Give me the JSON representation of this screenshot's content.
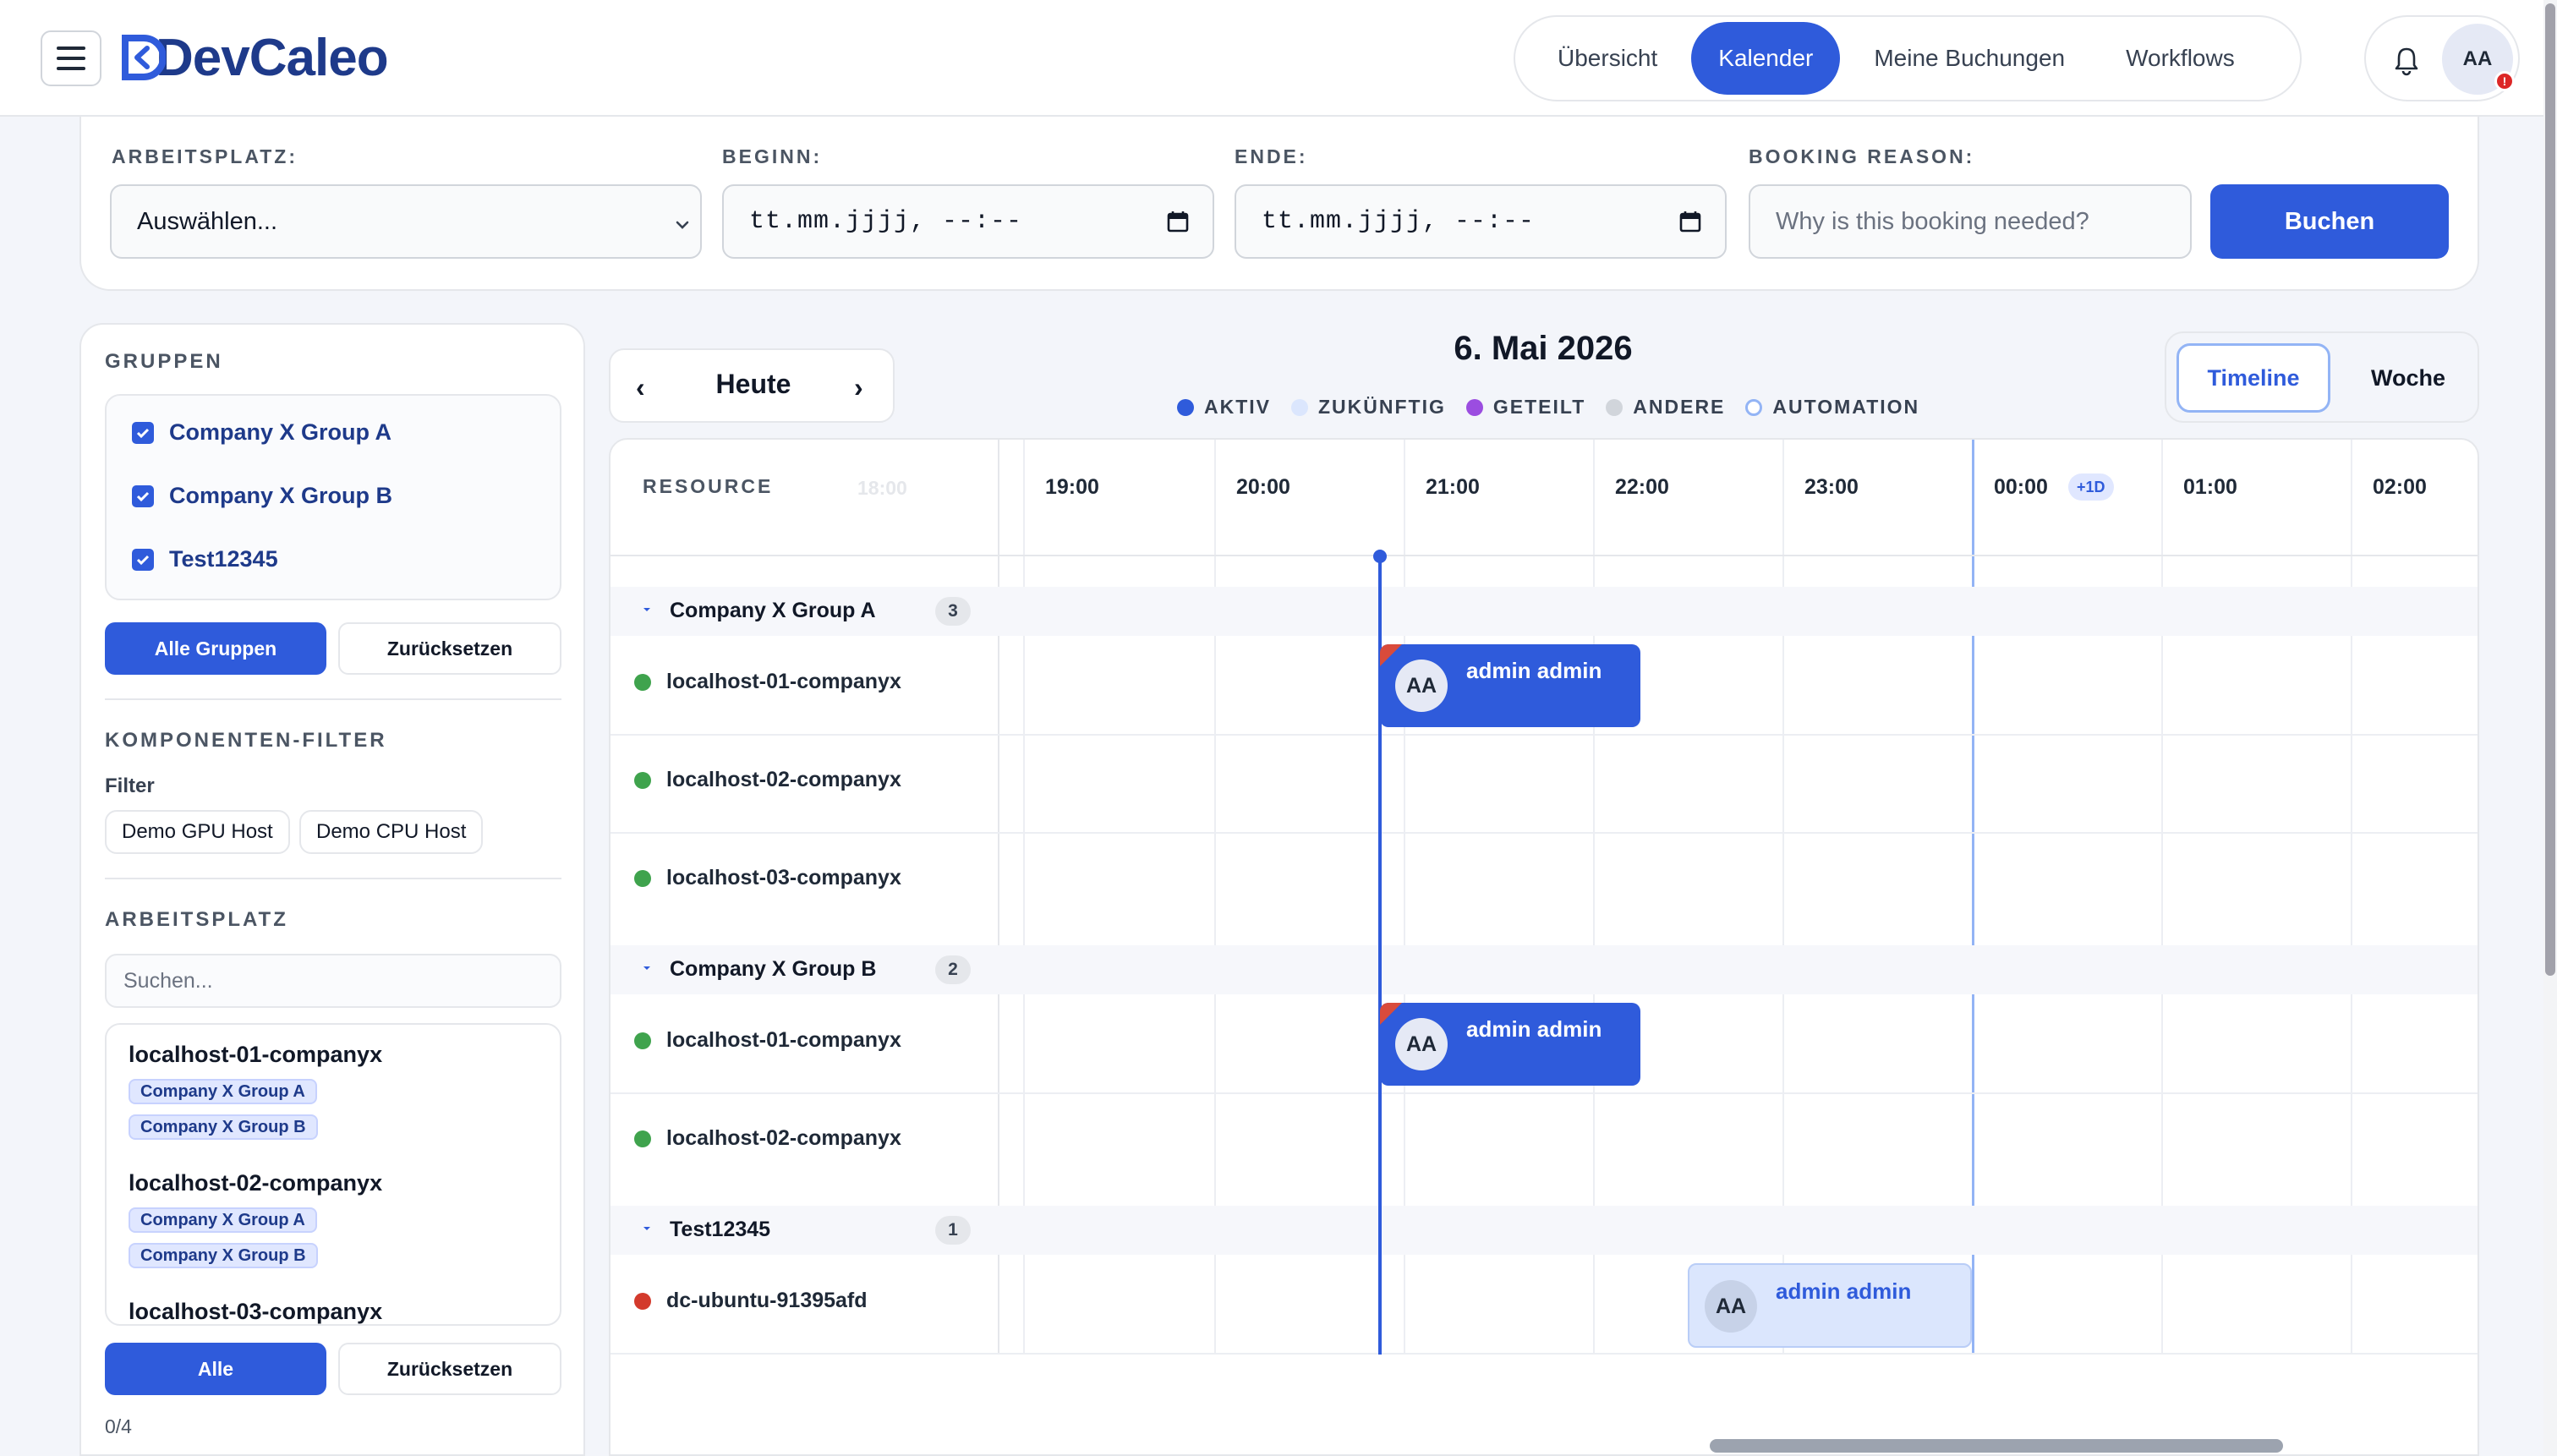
{
  "app": {
    "brand": "DevCaleo"
  },
  "nav": {
    "tabs": [
      {
        "label": "Übersicht",
        "active": false
      },
      {
        "label": "Kalender",
        "active": true
      },
      {
        "label": "Meine Buchungen",
        "active": false
      },
      {
        "label": "Workflows",
        "active": false
      }
    ]
  },
  "user": {
    "initials": "AA",
    "alert": "!"
  },
  "booking_form": {
    "workplace_label": "ARBEITSPLATZ:",
    "workplace_value": "Auswählen...",
    "start_label": "BEGINN:",
    "start_value": "tt.mm.jjjj, --:--",
    "end_label": "ENDE:",
    "end_value": "tt.mm.jjjj, --:--",
    "reason_label": "BOOKING REASON:",
    "reason_placeholder": "Why is this booking needed?",
    "submit_label": "Buchen"
  },
  "sidebar": {
    "groups_title": "GRUPPEN",
    "groups": [
      {
        "label": "Company X Group A",
        "checked": true
      },
      {
        "label": "Company X Group B",
        "checked": true
      },
      {
        "label": "Test12345",
        "checked": true
      }
    ],
    "groups_all_label": "Alle Gruppen",
    "groups_reset_label": "Zurücksetzen",
    "component_filter_title": "KOMPONENTEN-FILTER",
    "filter_label": "Filter",
    "filter_chips": [
      "Demo GPU Host",
      "Demo CPU Host"
    ],
    "workplace_title": "ARBEITSPLATZ",
    "search_placeholder": "Suchen...",
    "workplaces": [
      {
        "name": "localhost-01-companyx",
        "tags": [
          "Company X Group A",
          "Company X Group B"
        ]
      },
      {
        "name": "localhost-02-companyx",
        "tags": [
          "Company X Group A",
          "Company X Group B"
        ]
      },
      {
        "name": "localhost-03-companyx",
        "tags": []
      }
    ],
    "all_label": "Alle",
    "reset_label": "Zurücksetzen",
    "counter": "0/4"
  },
  "calendar": {
    "today_label": "Heute",
    "prev": "‹",
    "next": "›",
    "date_title": "6. Mai 2026",
    "legend": [
      {
        "label": "AKTIV",
        "color": "#2f5bdb"
      },
      {
        "label": "ZUKÜNFTIG",
        "color": "#dbe6fd"
      },
      {
        "label": "GETEILT",
        "color": "#9b4de0"
      },
      {
        "label": "ANDERE",
        "color": "#d1d5db"
      },
      {
        "label": "AUTOMATION",
        "color": "#93b4f5"
      }
    ],
    "views": {
      "timeline": "Timeline",
      "week": "Woche"
    },
    "resource_header": "RESOURCE",
    "ghost_hour": "18:00",
    "hours": [
      "19:00",
      "20:00",
      "21:00",
      "22:00",
      "23:00",
      "00:00",
      "01:00",
      "02:00"
    ],
    "next_day_badge": "+1D",
    "groups": [
      {
        "name": "Company X Group A",
        "count": "3",
        "rows": [
          {
            "name": "localhost-01-companyx",
            "status": "#3fa34d"
          },
          {
            "name": "localhost-02-companyx",
            "status": "#3fa34d"
          },
          {
            "name": "localhost-03-companyx",
            "status": "#3fa34d"
          }
        ]
      },
      {
        "name": "Company X Group B",
        "count": "2",
        "rows": [
          {
            "name": "localhost-01-companyx",
            "status": "#3fa34d"
          },
          {
            "name": "localhost-02-companyx",
            "status": "#3fa34d"
          }
        ]
      },
      {
        "name": "Test12345",
        "count": "1",
        "rows": [
          {
            "name": "dc-ubuntu-91395afd",
            "status": "#d33a2c"
          }
        ]
      }
    ],
    "bookings": [
      {
        "user": "admin admin",
        "initials": "AA",
        "kind": "active"
      },
      {
        "user": "admin admin",
        "initials": "AA",
        "kind": "active"
      },
      {
        "user": "admin admin",
        "initials": "AA",
        "kind": "future"
      }
    ]
  }
}
